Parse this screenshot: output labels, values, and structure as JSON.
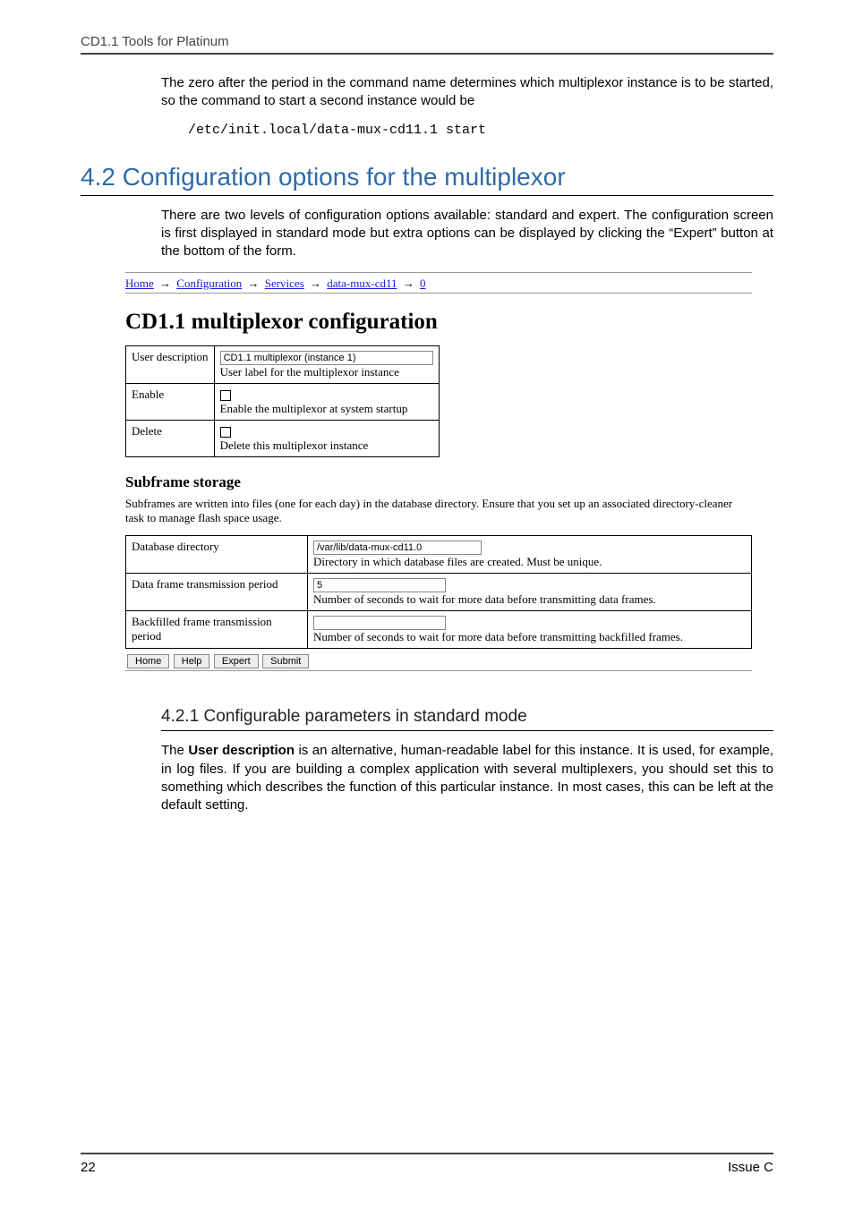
{
  "running_head": "CD1.1 Tools for Platinum",
  "intro_para": "The zero after the period in the command name determines which  multiplexor instance is to be started, so the command to start a second instance would be",
  "code_example": "/etc/init.local/data-mux-cd11.1 start",
  "section_heading": "4.2 Configuration options for the multiplexor",
  "section_para": "There are two levels of configuration options available: standard and expert.  The configuration screen is first displayed in standard mode but extra options can be displayed by clicking the “Expert” button at the bottom of the form.",
  "shot": {
    "crumbs": [
      "Home",
      "Configuration",
      "Services",
      "data-mux-cd11",
      "0"
    ],
    "crumb_sep": "→",
    "title": "CD1.1 multiplexor configuration",
    "cfg_rows": [
      {
        "label": "User description",
        "input": "CD1.1 multiplexor (instance 1)",
        "input_width": 230,
        "desc": "User label for the multiplexor instance",
        "checkbox": false
      },
      {
        "label": "Enable",
        "desc": "Enable the multiplexor at system startup",
        "checkbox": true
      },
      {
        "label": "Delete",
        "desc": "Delete this multiplexor instance",
        "checkbox": true
      }
    ],
    "sub_heading": "Subframe storage",
    "sub_para": "Subframes are written into files (one for each day) in the database directory. Ensure that you set up an associated directory-cleaner task to manage flash space usage.",
    "storage_rows": [
      {
        "label": "Database directory",
        "input": "/var/lib/data-mux-cd11.0",
        "input_width": 180,
        "desc": "Directory in which database files are created. Must be unique."
      },
      {
        "label": "Data frame transmission period",
        "input": "5",
        "input_width": 140,
        "desc": "Number of seconds to wait for more data before transmitting data frames."
      },
      {
        "label": "Backfilled frame transmission period",
        "input": "",
        "input_width": 140,
        "desc": "Number of seconds to wait for more data before transmitting backfilled frames."
      }
    ],
    "buttons": [
      "Home",
      "Help",
      "Expert",
      "Submit"
    ]
  },
  "subsection_heading": "4.2.1 Configurable parameters in standard mode",
  "subsection_para_pre": "The ",
  "subsection_para_bold": "User description",
  "subsection_para_post": " is an alternative, human-readable label for this instance.  It is used, for example, in log files.  If you are building a complex application with several multiplexers, you should set this to something which describes the function of this particular instance.  In most cases, this can be left at the default setting.",
  "footer_left": "22",
  "footer_right": "Issue C"
}
